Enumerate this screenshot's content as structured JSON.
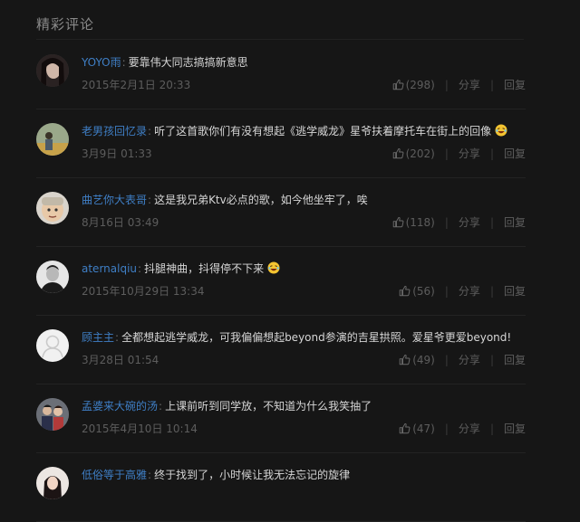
{
  "section_title": "精彩评论",
  "actions": {
    "share_label": "分享",
    "reply_label": "回复",
    "divider": "|"
  },
  "comments": [
    {
      "user": "YOYO雨",
      "text": "要靠伟大同志搞搞新意思",
      "date": "2015年2月1日 20:33",
      "likes": "(298)",
      "has_emoji": false
    },
    {
      "user": "老男孩回忆录",
      "text": "听了这首歌你们有没有想起《逃学威龙》星爷扶着摩托车在街上的回像",
      "date": "3月9日 01:33",
      "likes": "(202)",
      "has_emoji": true
    },
    {
      "user": "曲艺你大表哥",
      "text": "这是我兄弟Ktv必点的歌，如今他坐牢了，唉",
      "date": "8月16日 03:49",
      "likes": "(118)",
      "has_emoji": false
    },
    {
      "user": "aternalqiu",
      "text": "抖腿神曲，抖得停不下来",
      "date": "2015年10月29日 13:34",
      "likes": "(56)",
      "has_emoji": true
    },
    {
      "user": "顾主主",
      "text": "全都想起逃学威龙，可我偏偏想起beyond参演的吉星拱照。爱星爷更爱beyond!",
      "date": "3月28日 01:54",
      "likes": "(49)",
      "has_emoji": false
    },
    {
      "user": "孟婆来大碗的汤",
      "text": "上课前听到同学放，不知道为什么我笑抽了",
      "date": "2015年4月10日 10:14",
      "likes": "(47)",
      "has_emoji": false
    },
    {
      "user": "低俗等于高雅",
      "text": "终于找到了，小时候让我无法忘记的旋律",
      "date": "",
      "likes": "",
      "has_emoji": false
    }
  ],
  "colors": {
    "background": "#161616",
    "username": "#3f7fc6",
    "meta": "#5d5d5d"
  }
}
